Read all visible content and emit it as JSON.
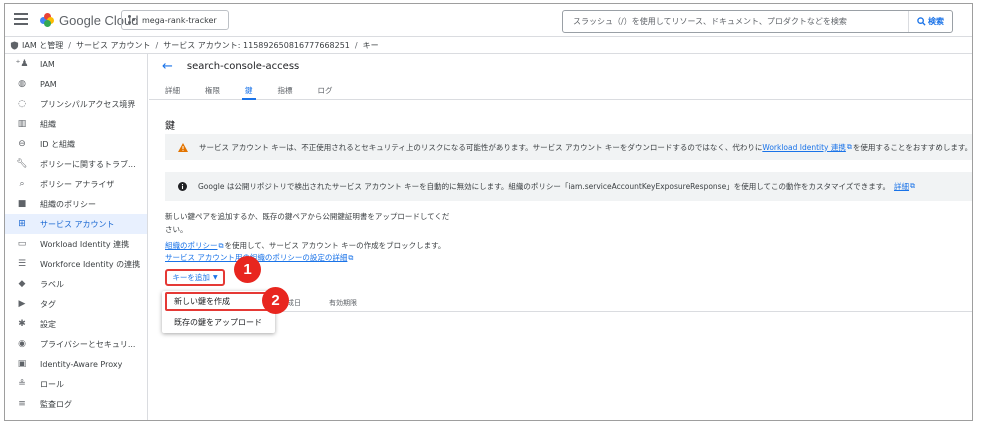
{
  "app": {
    "logo_text": "Google Cloud",
    "project": "mega-rank-tracker",
    "search_placeholder": "スラッシュ（/）を使用してリソース、ドキュメント、プロダクトなどを検索",
    "search_button": "検索"
  },
  "breadcrumb": {
    "items": [
      "IAM と管理",
      "サービス アカウント",
      "サービス アカウント: 115892650816777668251",
      "キー"
    ]
  },
  "sidebar": {
    "items": [
      {
        "label": "IAM",
        "icon": "person-add-icon"
      },
      {
        "label": "PAM",
        "icon": "shield-clock-icon"
      },
      {
        "label": "プリンシパルアクセス境界",
        "icon": "boundary-icon"
      },
      {
        "label": "組織",
        "icon": "org-icon"
      },
      {
        "label": "ID と組織",
        "icon": "id-icon"
      },
      {
        "label": "ポリシーに関するトラブ...",
        "icon": "wrench-icon"
      },
      {
        "label": "ポリシー アナライザ",
        "icon": "analyzer-icon"
      },
      {
        "label": "組織のポリシー",
        "icon": "policy-icon"
      },
      {
        "label": "サービス アカウント",
        "icon": "service-account-icon",
        "active": true
      },
      {
        "label": "Workload Identity 連携",
        "icon": "workload-icon"
      },
      {
        "label": "Workforce Identity の連携",
        "icon": "workforce-icon"
      },
      {
        "label": "ラベル",
        "icon": "label-icon"
      },
      {
        "label": "タグ",
        "icon": "tag-icon"
      },
      {
        "label": "設定",
        "icon": "settings-icon"
      },
      {
        "label": "プライバシーとセキュリ...",
        "icon": "privacy-icon"
      },
      {
        "label": "Identity-Aware Proxy",
        "icon": "iap-icon"
      },
      {
        "label": "ロール",
        "icon": "roles-icon"
      },
      {
        "label": "監査ログ",
        "icon": "audit-log-icon"
      }
    ]
  },
  "main": {
    "title": "search-console-access",
    "tabs": [
      "詳細",
      "権限",
      "鍵",
      "指標",
      "ログ"
    ],
    "active_tab": "鍵",
    "section_title": "鍵",
    "warning": {
      "text_before": "サービス アカウント キーは、不正使用されるとセキュリティ上のリスクになる可能性があります。サービス アカウント キーをダウンロードするのではなく、代わりに",
      "link": "Workload Identity 連携",
      "text_after": "を使用することをおすすめします。Google Clo"
    },
    "info": {
      "text": "Google は公開リポジトリで検出されたサービス アカウント キーを自動的に無効にします。組織のポリシー「iam.serviceAccountKeyExposureResponse」を使用してこの動作をカスタマイズできます。",
      "link": "詳細"
    },
    "body_text": "新しい鍵ペアを追加するか、既存の鍵ペアから公開鍵証明書をアップロードしてください。",
    "policy_link": "組織のポリシー",
    "policy_text": "を使用して、サービス アカウント キーの作成をブロックします。",
    "policy_detail_link": "サービス アカウント用の組織のポリシーの設定の詳細",
    "add_key_button": "キーを追加",
    "table_headers": {
      "created": "成日",
      "expiry": "有効期限"
    },
    "menu": [
      "新しい鍵を作成",
      "既存の鍵をアップロード"
    ]
  },
  "annotations": [
    "1",
    "2"
  ],
  "colors": {
    "accent": "#1a73e8",
    "active_bg": "#e8f0fe",
    "annotation": "#e8261f",
    "warning": "#e37400"
  }
}
